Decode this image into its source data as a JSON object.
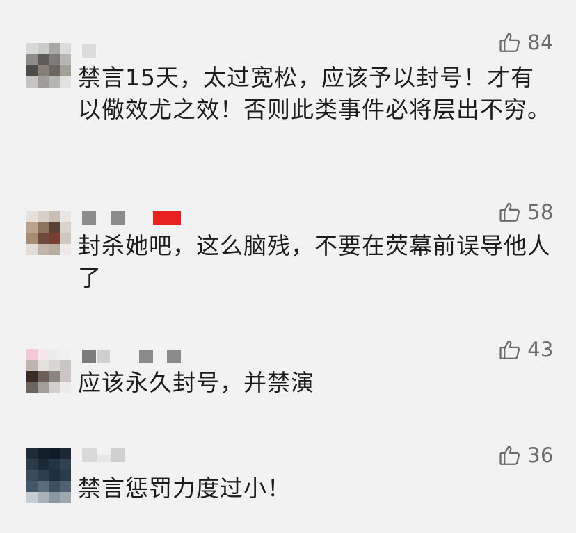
{
  "comments": [
    {
      "text": "禁言15天，太过宽松，应该予以封号！才有以儆效尤之效！否则此类事件必将层出不穷。",
      "likes": "84",
      "thumb_icon": "thumbs-up-icon"
    },
    {
      "text": "封杀她吧，这么脑残，不要在荧幕前误导他人了",
      "likes": "58",
      "thumb_icon": "thumbs-up-icon",
      "badge_color": "#e8231f"
    },
    {
      "text": "应该永久封号，并禁演",
      "likes": "43",
      "thumb_icon": "thumbs-up-icon"
    },
    {
      "text": "禁言惩罚力度过小！",
      "likes": "36",
      "thumb_icon": "thumbs-up-icon"
    }
  ],
  "colors": {
    "background": "#f2f2f2",
    "text": "#1c1c1c",
    "like": "#6b6b6b"
  }
}
